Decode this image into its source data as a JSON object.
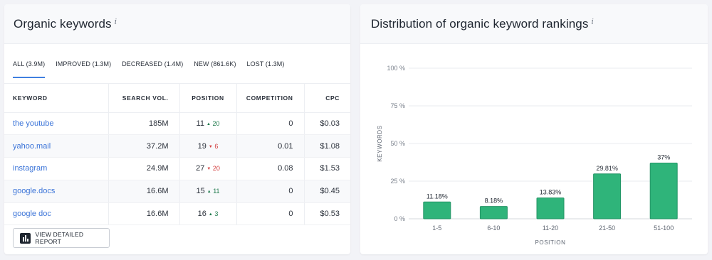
{
  "left_panel": {
    "title": "Organic keywords",
    "info": "i",
    "tabs": [
      {
        "label": "ALL (3.9M)",
        "active": true
      },
      {
        "label": "IMPROVED (1.3M)",
        "active": false
      },
      {
        "label": "DECREASED (1.4M)",
        "active": false
      },
      {
        "label": "NEW (861.6K)",
        "active": false
      },
      {
        "label": "LOST (1.3M)",
        "active": false
      }
    ],
    "table": {
      "headers": {
        "keyword": "KEYWORD",
        "volume": "SEARCH VOL.",
        "position": "POSITION",
        "competition": "COMPETITION",
        "cpc": "CPC"
      },
      "rows": [
        {
          "keyword": "the youtube",
          "volume": "185M",
          "position": "11",
          "delta": "20",
          "direction": "up",
          "competition": "0",
          "cpc": "$0.03"
        },
        {
          "keyword": "yahoo.mail",
          "volume": "37.2M",
          "position": "19",
          "delta": "6",
          "direction": "down",
          "competition": "0.01",
          "cpc": "$1.08"
        },
        {
          "keyword": "instagram",
          "volume": "24.9M",
          "position": "27",
          "delta": "20",
          "direction": "down",
          "competition": "0.08",
          "cpc": "$1.53"
        },
        {
          "keyword": "google.docs",
          "volume": "16.6M",
          "position": "15",
          "delta": "11",
          "direction": "up",
          "competition": "0",
          "cpc": "$0.45"
        },
        {
          "keyword": "google doc",
          "volume": "16.6M",
          "position": "16",
          "delta": "3",
          "direction": "up",
          "competition": "0",
          "cpc": "$0.53"
        }
      ]
    },
    "button_label": "VIEW DETAILED REPORT"
  },
  "right_panel": {
    "title": "Distribution of organic keyword rankings",
    "info": "i"
  },
  "colors": {
    "bar": "#2fb47a",
    "bar_border": "#249466",
    "link": "#3b74d8",
    "up": "#1f7a4c",
    "down": "#d23c3c",
    "accent": "#3f7fe0"
  },
  "chart_data": {
    "type": "bar",
    "categories": [
      "1-5",
      "6-10",
      "11-20",
      "21-50",
      "51-100"
    ],
    "values": [
      11.18,
      8.18,
      13.83,
      29.81,
      37
    ],
    "data_labels": [
      "11.18%",
      "8.18%",
      "13.83%",
      "29.81%",
      "37%"
    ],
    "yticks": [
      "0 %",
      "25 %",
      "50 %",
      "75 %",
      "100 %"
    ],
    "ylim": [
      0,
      100
    ],
    "xlabel": "POSITION",
    "ylabel": "KEYWORDS",
    "grid": true
  }
}
